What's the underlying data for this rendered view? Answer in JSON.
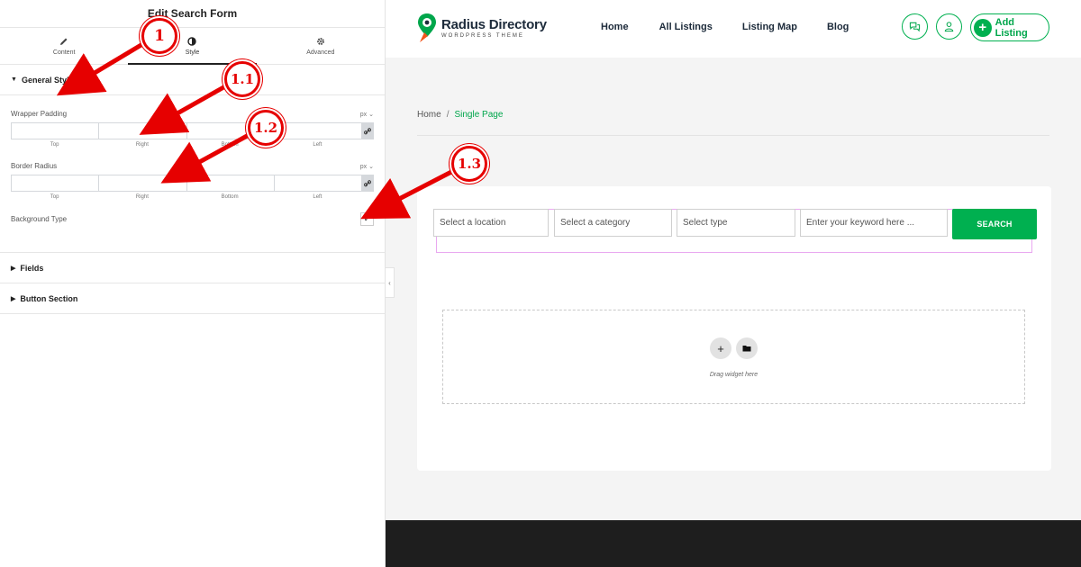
{
  "panel": {
    "title": "Edit Search Form",
    "tabs": [
      {
        "label": "Content",
        "icon": "pencil-icon"
      },
      {
        "label": "Style",
        "icon": "half-circle-icon"
      },
      {
        "label": "Advanced",
        "icon": "gear-icon"
      }
    ],
    "active_tab": "Style",
    "sections": {
      "general": {
        "title": "General Style",
        "wrapper_padding": {
          "label": "Wrapper Padding",
          "unit": "px",
          "sides": [
            "Top",
            "Right",
            "Bottom",
            "Left"
          ]
        },
        "border_radius": {
          "label": "Border Radius",
          "unit": "px",
          "sides": [
            "Top",
            "Right",
            "Bottom",
            "Left"
          ]
        },
        "background_type": {
          "label": "Background Type",
          "toggle_symbol": "✓"
        }
      },
      "fields": {
        "title": "Fields"
      },
      "button": {
        "title": "Button Section"
      }
    }
  },
  "site": {
    "logo": {
      "title": "Radius Directory",
      "subtitle": "WORDPRESS THEME"
    },
    "nav": [
      "Home",
      "All Listings",
      "Listing Map",
      "Blog"
    ],
    "add_listing_label": "Add Listing",
    "breadcrumb": {
      "home": "Home",
      "separator": "/",
      "current": "Single Page"
    },
    "search_form": {
      "location_placeholder": "Select a location",
      "category_placeholder": "Select a category",
      "type_placeholder": "Select type",
      "keyword_placeholder": "Enter your keyword here ...",
      "button_label": "SEARCH"
    },
    "drop_zone_text": "Drag widget here"
  },
  "annotations": [
    "1",
    "1.1",
    "1.2",
    "1.3"
  ],
  "colors": {
    "accent": "#00b050",
    "annotation": "#e60000",
    "outline": "#e9a8f0"
  }
}
